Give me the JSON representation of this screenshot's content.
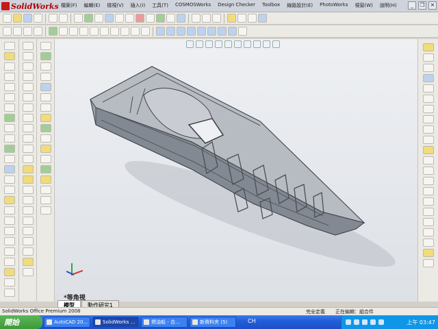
{
  "app": {
    "logo": "SolidWorks"
  },
  "menu": [
    "檔案(F)",
    "編輯(E)",
    "檢視(V)",
    "插入(I)",
    "工具(T)",
    "COSMOSWorks",
    "Design Checker",
    "Toolbox",
    "線路設計(E)",
    "PhotoWorks",
    "視窗(W)",
    "說明(H)"
  ],
  "viewport": {
    "view_name": "*等角視"
  },
  "tabs": [
    {
      "label": "模型"
    },
    {
      "label": "動作研究1"
    }
  ],
  "status": {
    "product": "SolidWorks Office Premium 2008",
    "constraint": "完全定義",
    "editing": "正在編輯：組合件"
  },
  "taskbar": {
    "start_label": "開始",
    "tasks": [
      "AutoCAD 20...",
      "SolidWorks ...",
      "燃油船 - 合...",
      "新資料夾 (5)"
    ],
    "language": "CH",
    "clock": "上午 03:47"
  },
  "colors": {
    "taskbar": "#245edb",
    "viewport": "#e6e9ee",
    "hull": "#8f949c"
  }
}
